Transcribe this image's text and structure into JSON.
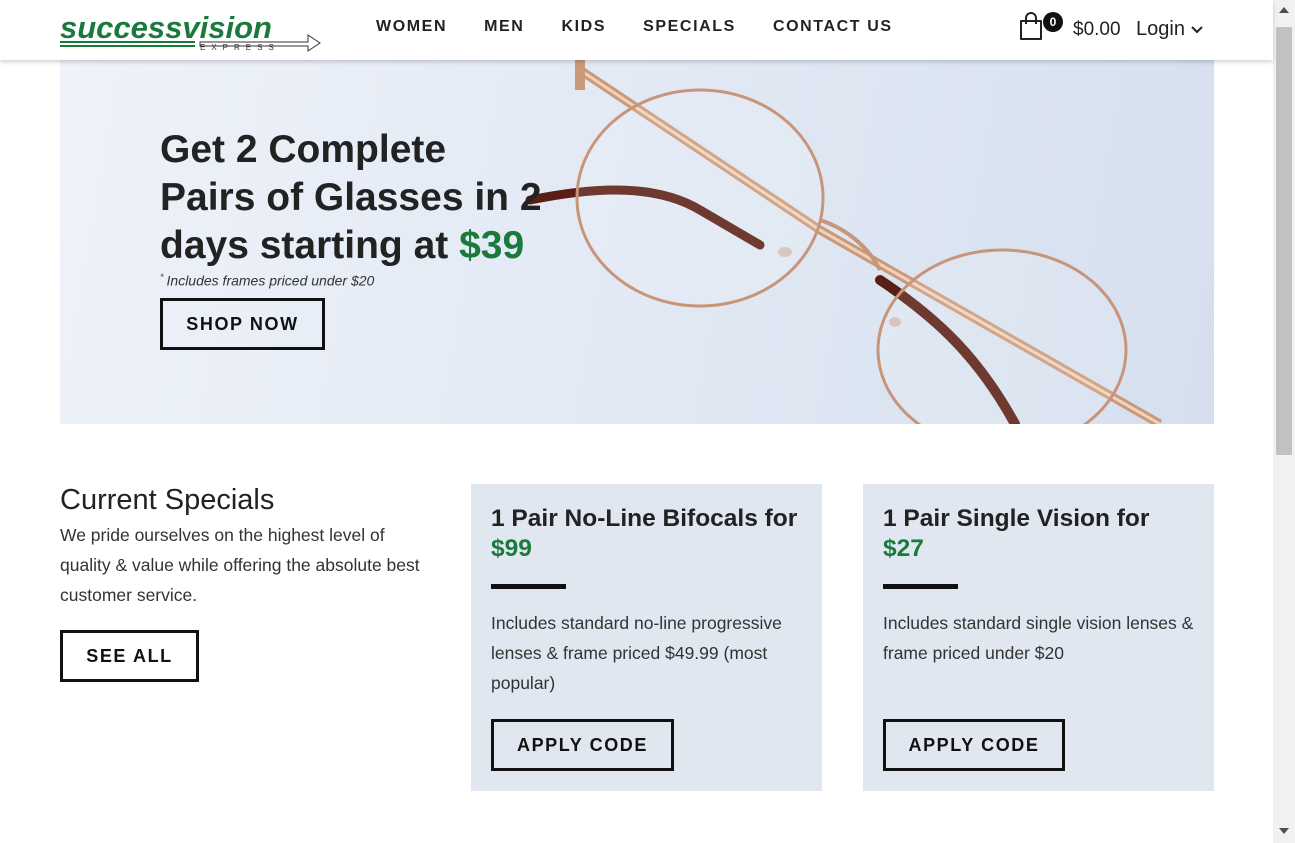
{
  "brand": {
    "logo_main": "successvision",
    "logo_sub": "EXPRESS",
    "color_green": "#1a7a3c"
  },
  "nav": {
    "items": [
      "WOMEN",
      "MEN",
      "KIDS",
      "SPECIALS",
      "CONTACT US"
    ]
  },
  "cart": {
    "icon": "shopping-bag-icon",
    "count": "0",
    "total": "$0.00"
  },
  "account": {
    "login_label": "Login",
    "icon": "chevron-down-icon"
  },
  "hero": {
    "title_line1": "Get 2 Complete",
    "title_line2": "Pairs of Glasses in 2",
    "title_line3": "days starting at ",
    "title_price": "$39",
    "footnote_mark": "*",
    "footnote": "Includes frames priced under $20",
    "cta_label": "SHOP NOW"
  },
  "specials": {
    "title": "Current Specials",
    "description": "We pride ourselves on the highest level of quality & value while offering the absolute best customer service.",
    "see_all_label": "SEE ALL",
    "cards": [
      {
        "title": "1 Pair No-Line Bifocals for ",
        "price": "$99",
        "description": "Includes standard no-line progressive lenses & frame priced $49.99 (most popular)",
        "button_label": "APPLY CODE"
      },
      {
        "title": "1 Pair Single Vision for ",
        "price": "$27",
        "description": "Includes standard single vision lenses & frame priced under $20",
        "button_label": "APPLY CODE"
      }
    ]
  }
}
